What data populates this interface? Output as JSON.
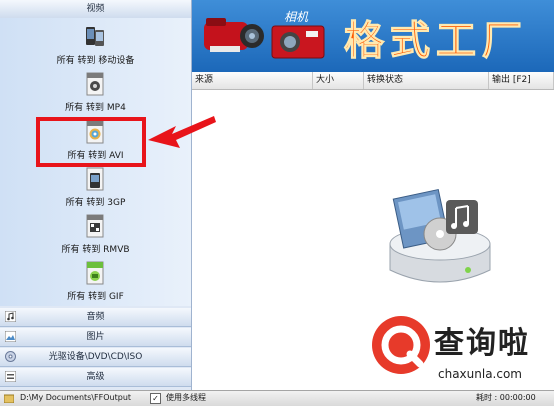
{
  "left_panel": {
    "category_top": "视频",
    "formats": [
      {
        "label": "所有 转到 移动设备",
        "icon": "mobile-device-icon"
      },
      {
        "label": "所有 转到 MP4",
        "icon": "mp4-file-icon"
      },
      {
        "label": "所有 转到 AVI",
        "icon": "avi-file-icon"
      },
      {
        "label": "所有 转到 3GP",
        "icon": "3gp-file-icon"
      },
      {
        "label": "所有 转到 RMVB",
        "icon": "rmvb-file-icon"
      },
      {
        "label": "所有 转到 GIF",
        "icon": "gif-file-icon"
      }
    ],
    "categories": [
      {
        "label": "音频",
        "icon": "audio-icon"
      },
      {
        "label": "图片",
        "icon": "image-icon"
      },
      {
        "label": "光驱设备\\DVD\\CD\\ISO",
        "icon": "disc-icon"
      },
      {
        "label": "高级",
        "icon": "advanced-icon"
      }
    ]
  },
  "banner": {
    "title": "格式工厂",
    "camera_label": "相机"
  },
  "table": {
    "columns": [
      "来源",
      "大小",
      "转换状态",
      "输出 [F2]"
    ]
  },
  "status": {
    "output_path": "D:\\My Documents\\FFOutput",
    "multithread_label": "使用多线程",
    "multithread_checked": true,
    "elapsed": "耗时 : 00:00:00"
  },
  "watermark": {
    "brand": "查询啦",
    "url": "chaxunla.com"
  },
  "colors": {
    "highlight": "#e8141a",
    "banner_title": "#ff5a00",
    "banner_bg": "#2a79c9"
  }
}
